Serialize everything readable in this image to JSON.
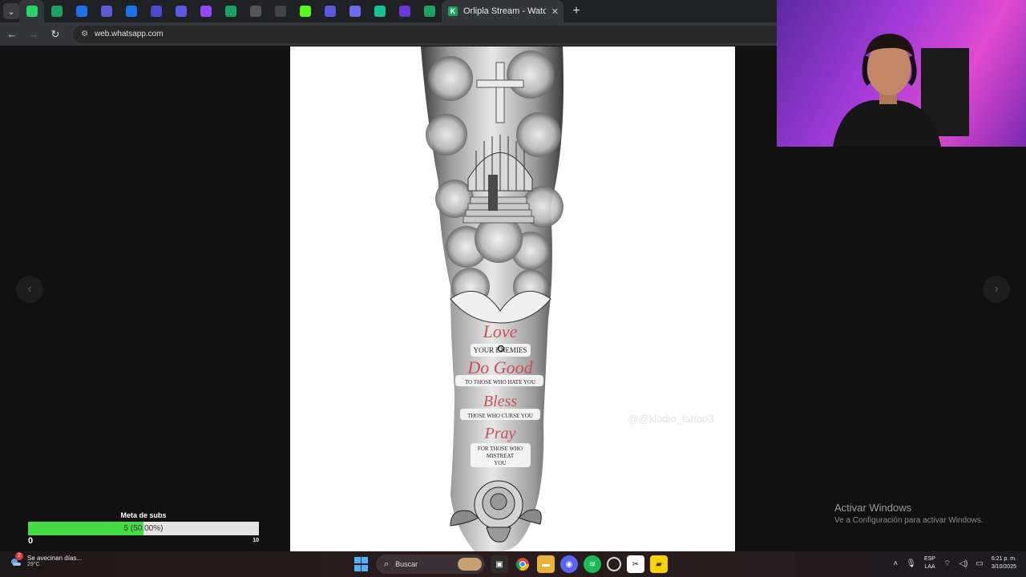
{
  "browser": {
    "active_tab_title": "Orlipla Stream - Watch Live on",
    "pinned_tabs": [
      {
        "icon": "whatsapp-icon",
        "color": "#25d366"
      },
      {
        "icon": "sheets-icon",
        "color": "#1aa260"
      },
      {
        "icon": "edge-icon",
        "color": "#1a73e8"
      },
      {
        "icon": "meet-icon",
        "color": "#5b5bd6"
      },
      {
        "icon": "edge-icon",
        "color": "#1a73e8"
      },
      {
        "icon": "video-icon",
        "color": "#4a4ad0"
      },
      {
        "icon": "video-icon",
        "color": "#5a5ae0"
      },
      {
        "icon": "twitch-icon",
        "color": "#9146ff"
      },
      {
        "icon": "sheets-icon",
        "color": "#1aa260"
      },
      {
        "icon": "openai-icon",
        "color": "#555555"
      },
      {
        "icon": "pcloud-icon",
        "color": "#444444"
      },
      {
        "icon": "kick-icon",
        "color": "#53fc18"
      },
      {
        "icon": "chat-icon",
        "color": "#5a5ae0"
      },
      {
        "icon": "sync-icon",
        "color": "#6c6cf0"
      },
      {
        "icon": "grammarly-icon",
        "color": "#15c39a"
      },
      {
        "icon": "jira-icon",
        "color": "#6a3ad8"
      },
      {
        "icon": "sheets-icon",
        "color": "#1aa260"
      }
    ],
    "url": "web.whatsapp.com"
  },
  "watermark": {
    "line1": "Activar Windows",
    "line2": "Ve a Configuración para activar Windows."
  },
  "image_text": {
    "love": "Love",
    "your_enemies": "YOUR ENEMIES",
    "do_good": "Do Good",
    "to_those": "TO THOSE   WHO HATE YOU",
    "bless": "Bless",
    "curse": "THOSE   WHO CURSE YOU",
    "pray": "Pray",
    "mistreat1": "FOR THOSE WHO",
    "mistreat2": "MISTREAT",
    "mistreat3": "YOU",
    "credit": "@@klodio_tattoo3"
  },
  "sub_goal": {
    "label": "Meta de subs",
    "current": 5,
    "target": 10,
    "min": "0",
    "max_label": "10",
    "bar_text": "5 (50.00%)",
    "fill_color": "#44dd44"
  },
  "taskbar": {
    "weather_text": "Se avecinan días...",
    "temp": "29°C",
    "notification_count": "2",
    "search_placeholder": "Buscar",
    "lang1": "ESP",
    "lang2": "LAA",
    "time": "6:21 p. m.",
    "date": "3/10/2025"
  }
}
